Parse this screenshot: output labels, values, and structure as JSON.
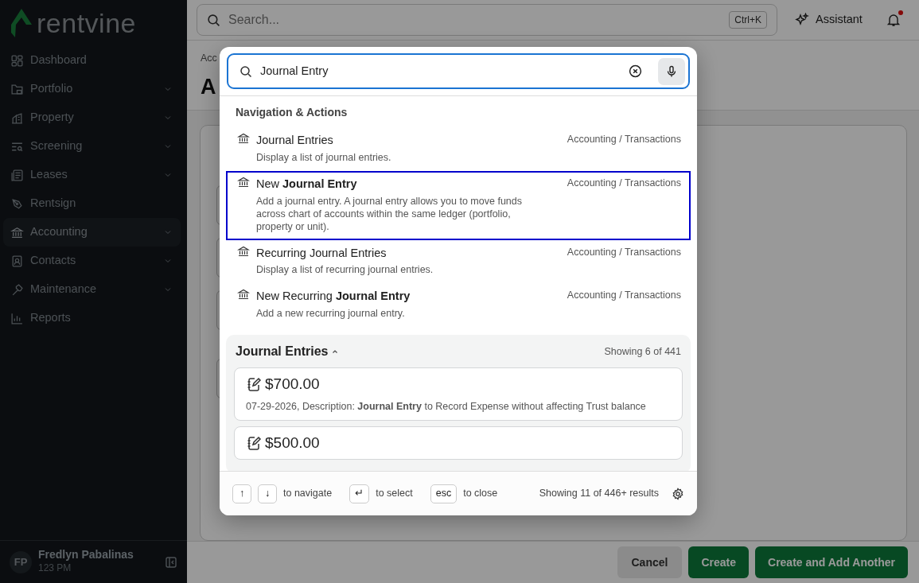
{
  "brand": {
    "name": "rentvine"
  },
  "sidebar": {
    "items": [
      {
        "label": "Dashboard",
        "kind": "link",
        "selected": false
      },
      {
        "label": "Portfolio",
        "kind": "group",
        "selected": false
      },
      {
        "label": "Property",
        "kind": "group",
        "selected": false
      },
      {
        "label": "Screening",
        "kind": "group",
        "selected": false
      },
      {
        "label": "Leases",
        "kind": "group",
        "selected": false
      },
      {
        "label": "Rentsign",
        "kind": "link",
        "selected": false
      },
      {
        "label": "Accounting",
        "kind": "group",
        "selected": true
      },
      {
        "label": "Contacts",
        "kind": "group",
        "selected": false
      },
      {
        "label": "Maintenance",
        "kind": "group",
        "selected": false
      },
      {
        "label": "Reports",
        "kind": "link",
        "selected": false
      }
    ],
    "user": {
      "initials": "FP",
      "name": "Fredlyn Pabalinas",
      "subtitle": "123 PM"
    }
  },
  "topbar": {
    "search": {
      "placeholder": "Search..."
    },
    "shortcut": "Ctrl+K",
    "assistant": "Assistant",
    "notifications": {
      "unread": true
    }
  },
  "page": {
    "breadcrumb": "Acc",
    "title": "A"
  },
  "actions": [
    "Cancel",
    "Create",
    "Create and Add Another"
  ],
  "palette": {
    "query": "Journal Entry",
    "section_title": "Navigation & Actions",
    "results": [
      {
        "title": "Journal Entries",
        "description": "Display a list of journal entries.",
        "category": "Accounting / Transactions",
        "selected": false
      },
      {
        "title": "New **Journal Entry**",
        "description": "Add a journal entry. A journal entry allows you to move funds across chart of accounts within the same ledger (portfolio, property or unit).",
        "category": "Accounting / Transactions",
        "selected": true
      },
      {
        "title": "Recurring Journal Entries",
        "description": "Display a list of recurring journal entries.",
        "category": "Accounting / Transactions",
        "selected": false
      },
      {
        "title": "New Recurring **Journal Entry**",
        "description": "Add a new recurring journal entry.",
        "category": "Accounting / Transactions",
        "selected": false
      }
    ],
    "group": {
      "title": "Journal Entries",
      "expanded": true,
      "count": "Showing 6 of 441",
      "entries": [
        {
          "amount": "$700.00",
          "description": "07-29-2026, Description: **Journal Entry** to Record Expense without affecting Trust balance"
        },
        {
          "amount": "$500.00"
        }
      ]
    },
    "footer": {
      "hints": [
        {
          "keys": [
            "↑",
            "↓"
          ],
          "label": "to navigate"
        },
        {
          "keys": [
            "↵"
          ],
          "label": "to select"
        },
        {
          "keys": [
            "esc"
          ],
          "label": "to close"
        }
      ],
      "summary": "Showing 11 of 446+ results"
    }
  }
}
